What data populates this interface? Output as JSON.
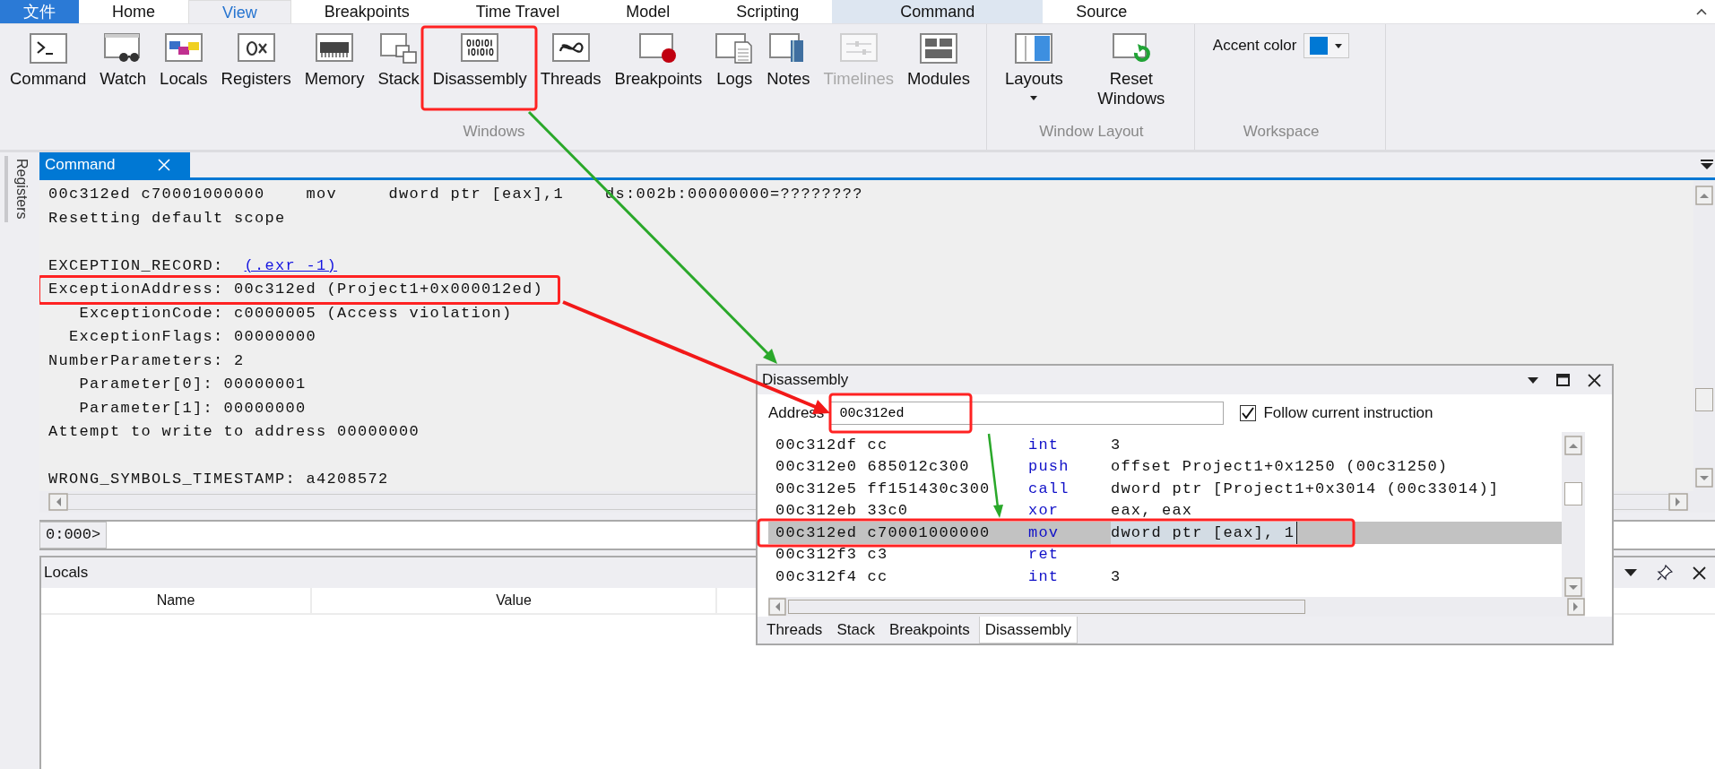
{
  "ribbon_tabs": [
    {
      "label": "文件",
      "kind": "file",
      "selected": false
    },
    {
      "label": "Home",
      "kind": "plain",
      "selected": false
    },
    {
      "label": "View",
      "kind": "plain",
      "selected": true
    },
    {
      "label": "Breakpoints",
      "kind": "plain",
      "selected": false
    },
    {
      "label": "Time Travel",
      "kind": "plain",
      "selected": false
    },
    {
      "label": "Model",
      "kind": "plain",
      "selected": false
    },
    {
      "label": "Scripting",
      "kind": "plain",
      "selected": false
    },
    {
      "label": "Command",
      "kind": "contextual",
      "selected": false
    },
    {
      "label": "Source",
      "kind": "plain",
      "selected": false
    }
  ],
  "ribbon_groups": [
    {
      "label": "Windows",
      "kind": "buttons",
      "buttons": [
        {
          "label": "Command",
          "disabled": false,
          "dropdown": false
        },
        {
          "label": "Watch",
          "disabled": false,
          "dropdown": false
        },
        {
          "label": "Locals",
          "disabled": false,
          "dropdown": false
        },
        {
          "label": "Registers",
          "disabled": false,
          "dropdown": false
        },
        {
          "label": "Memory",
          "disabled": false,
          "dropdown": false
        },
        {
          "label": "Stack",
          "disabled": false,
          "dropdown": false
        },
        {
          "label": "Disassembly",
          "disabled": false,
          "dropdown": false
        },
        {
          "label": "Threads",
          "disabled": false,
          "dropdown": false
        },
        {
          "label": "Breakpoints",
          "disabled": false,
          "dropdown": false
        },
        {
          "label": "Logs",
          "disabled": false,
          "dropdown": false
        },
        {
          "label": "Notes",
          "disabled": false,
          "dropdown": false
        },
        {
          "label": "Timelines",
          "disabled": true,
          "dropdown": false
        },
        {
          "label": "Modules",
          "disabled": false,
          "dropdown": false
        }
      ]
    },
    {
      "label": "Window Layout",
      "kind": "buttons",
      "buttons": [
        {
          "label": "Layouts",
          "disabled": false,
          "dropdown": true
        },
        {
          "label": "Reset Windows",
          "disabled": false,
          "dropdown": false
        }
      ]
    },
    {
      "label": "Workspace",
      "kind": "accent",
      "accent": {
        "label": "Accent color",
        "color": "#0078d4"
      }
    }
  ],
  "side_tabs": [
    {
      "label": "Registers"
    }
  ],
  "command_panel": {
    "tab": {
      "label": "Command",
      "selected": true
    },
    "lines": [
      {
        "kind": "text",
        "text": "00c312ed c70001000000    mov     dword ptr [eax],1    ds:002b:00000000=????????"
      },
      {
        "kind": "text",
        "text": "Resetting default scope"
      },
      {
        "kind": "blank"
      },
      {
        "kind": "link",
        "text": "EXCEPTION_RECORD:  ",
        "link": "(.exr -1)"
      },
      {
        "kind": "text",
        "text": "ExceptionAddress: 00c312ed (Project1+0x000012ed)"
      },
      {
        "kind": "text",
        "text": "   ExceptionCode: c0000005 (Access violation)"
      },
      {
        "kind": "text",
        "text": "  ExceptionFlags: 00000000"
      },
      {
        "kind": "text",
        "text": "NumberParameters: 2"
      },
      {
        "kind": "text",
        "text": "   Parameter[0]: 00000001"
      },
      {
        "kind": "text",
        "text": "   Parameter[1]: 00000000"
      },
      {
        "kind": "text",
        "text": "Attempt to write to address 00000000"
      },
      {
        "kind": "blank"
      },
      {
        "kind": "text",
        "text": "WRONG_SYMBOLS_TIMESTAMP: a4208572"
      }
    ],
    "prompt": "0:000>"
  },
  "locals": {
    "title": "Locals",
    "columns": [
      "Name",
      "Value"
    ]
  },
  "disassembly": {
    "title": "Disassembly",
    "address_label": "Address",
    "address": "00c312ed",
    "follow": {
      "label": "Follow current instruction",
      "checked": true
    },
    "rows": [
      {
        "address": "00c312df",
        "bytes": "cc",
        "mnemonic": "int",
        "operands": "3",
        "selected": false
      },
      {
        "address": "00c312e0",
        "bytes": "685012c300",
        "mnemonic": "push",
        "operands": "offset Project1+0x1250 (00c31250)",
        "selected": false
      },
      {
        "address": "00c312e5",
        "bytes": "ff151430c300",
        "mnemonic": "call",
        "operands": "dword ptr [Project1+0x3014 (00c33014)]",
        "selected": false
      },
      {
        "address": "00c312eb",
        "bytes": "33c0",
        "mnemonic": "xor",
        "operands": "eax, eax",
        "selected": false
      },
      {
        "address": "00c312ed",
        "bytes": "c70001000000",
        "mnemonic": "mov",
        "operands": "dword ptr [eax], 1",
        "selected": true
      },
      {
        "address": "00c312f3",
        "bytes": "c3",
        "mnemonic": "ret",
        "operands": "",
        "selected": false
      },
      {
        "address": "00c312f4",
        "bytes": "cc",
        "mnemonic": "int",
        "operands": "3",
        "selected": false
      }
    ],
    "tabs": [
      {
        "label": "Threads",
        "selected": false
      },
      {
        "label": "Stack",
        "selected": false
      },
      {
        "label": "Breakpoints",
        "selected": false
      },
      {
        "label": "Disassembly",
        "selected": true
      }
    ]
  }
}
